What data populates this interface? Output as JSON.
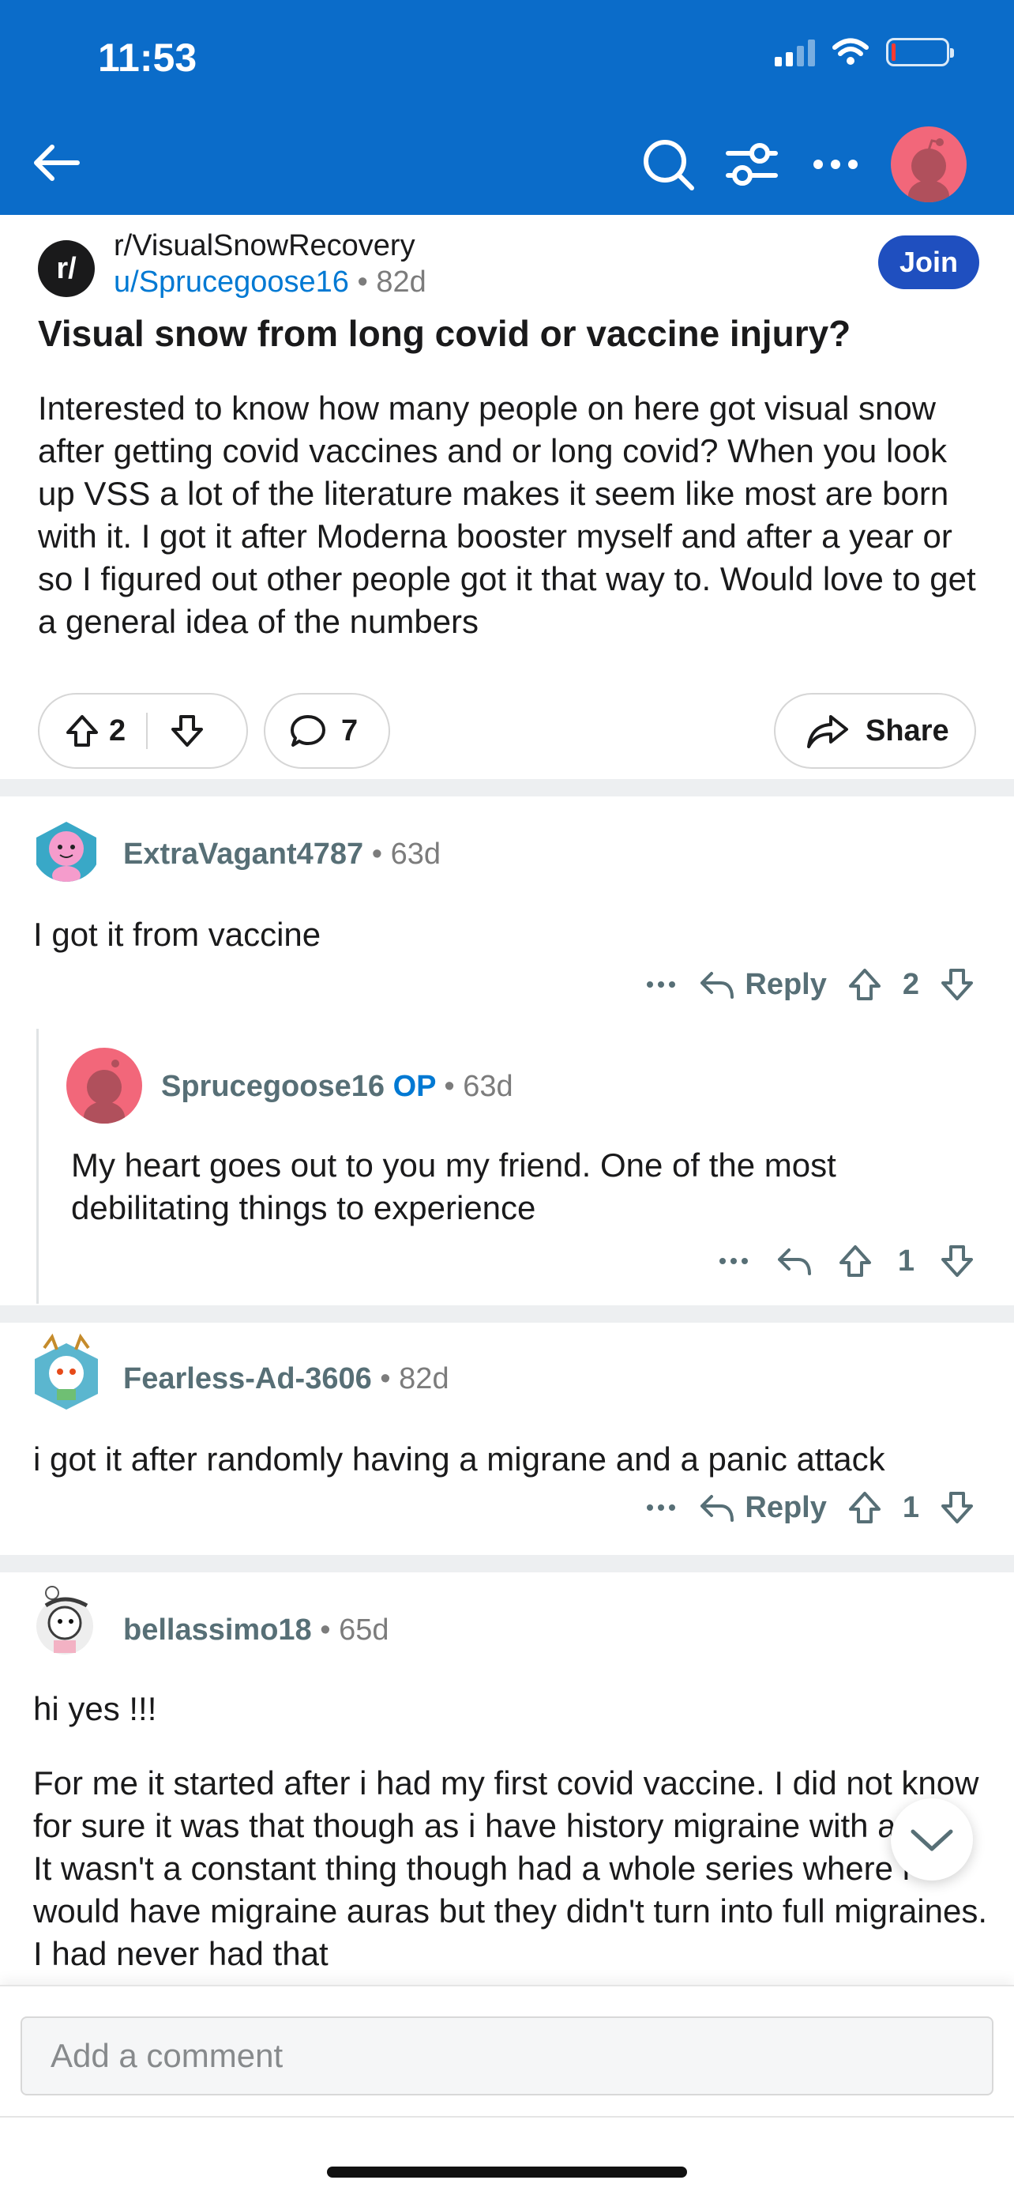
{
  "status": {
    "time": "11:53"
  },
  "nav": {
    "icons": [
      "back-arrow-icon",
      "search-icon",
      "filter-icon",
      "more-icon",
      "profile-avatar"
    ]
  },
  "post": {
    "subreddit": "r/VisualSnowRecovery",
    "sub_icon_text": "r/",
    "author": "u/Sprucegoose16",
    "age": "82d",
    "join_label": "Join",
    "title": "Visual snow from long covid or vaccine injury?",
    "body": "Interested to know how many people on here got visual snow after getting covid vaccines and or long covid? When you look up VSS a lot of the literature makes it seem like most are born with it. I got it after Moderna booster myself and after a year or so I figured out other people got it that way to. Would love to get a general idea of the numbers",
    "upvotes": "2",
    "comments": "7",
    "share_label": "Share"
  },
  "comments": [
    {
      "author": "ExtraVagant4787",
      "age": "63d",
      "text": "I got it from vaccine",
      "reply_label": "Reply",
      "votes": "2"
    },
    {
      "author": "Sprucegoose16",
      "op": "OP",
      "age": "63d",
      "text": "My heart goes out to you my friend. One of the most debilitating things to experience",
      "votes": "1"
    },
    {
      "author": "Fearless-Ad-3606",
      "age": "82d",
      "text": "i got it after randomly having a migrane and a panic attack",
      "reply_label": "Reply",
      "votes": "1"
    },
    {
      "author": "bellassimo18",
      "age": "65d",
      "text1": "hi yes !!!",
      "text2": "For me it started after i had my first covid vaccine. I did not know for sure it was that though as i have history migraine with auras. It wasn't a constant thing though had a whole series where i would have migraine auras but they didn't turn into full migraines. I had never had that"
    }
  ],
  "composer": {
    "placeholder": "Add a comment"
  },
  "colors": {
    "topbar": "#0b6cc9",
    "join": "#1f4fbf",
    "link": "#0079d3",
    "avatar_me": "#f2677a"
  }
}
